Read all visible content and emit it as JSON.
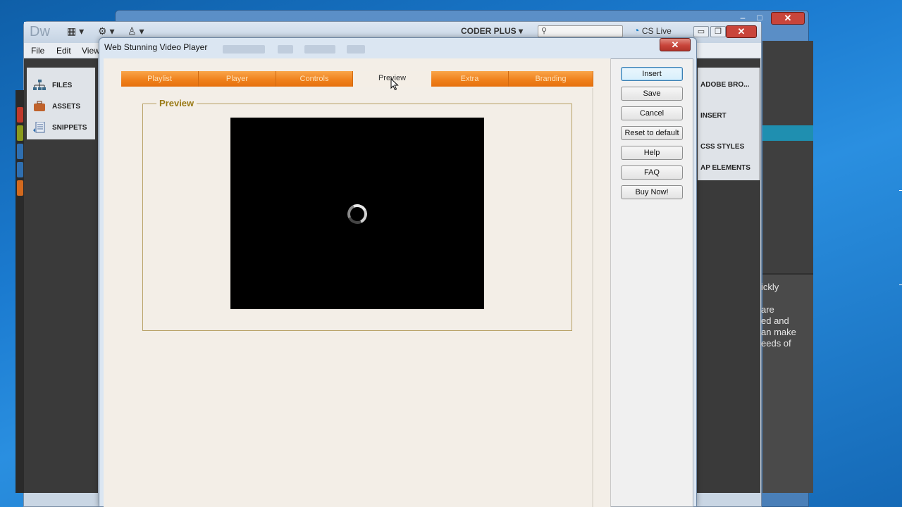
{
  "colors": {
    "tab_orange": "#ef7f1a",
    "group_label": "#9a7a15",
    "close_red": "#c9453b"
  },
  "back_window": {
    "controls": {
      "minimize": "–",
      "maximize": "□",
      "close": "✕"
    }
  },
  "dreamweaver": {
    "logo": "Dw",
    "workspace_label": "CODER PLUS",
    "search_placeholder": "",
    "cs_live": "CS Live",
    "window_controls": {
      "minimize": "▭",
      "restore": "❐",
      "close": "✕"
    },
    "menu": [
      "File",
      "Edit",
      "View"
    ],
    "right_menu_controls": "–  □  ✕",
    "files_panel": [
      {
        "label": "FILES",
        "icon": "sitemap-icon"
      },
      {
        "label": "ASSETS",
        "icon": "briefcase-icon"
      },
      {
        "label": "SNIPPETS",
        "icon": "snippets-icon"
      }
    ],
    "right_panel": [
      "ADOBE BRO...",
      "INSERT",
      "CSS STYLES",
      "AP ELEMENTS"
    ],
    "help_text": [
      "ickly",
      "are",
      "ed and",
      "an make",
      "eeds of"
    ]
  },
  "dialog": {
    "title": "Web Stunning Video Player",
    "close": "✕",
    "tabs": [
      {
        "label": "Playlist",
        "active": false
      },
      {
        "label": "Player",
        "active": false
      },
      {
        "label": "Controls",
        "active": false
      },
      {
        "label": "Preview",
        "active": true
      },
      {
        "label": "Extra",
        "active": false
      },
      {
        "label": "Branding",
        "active": false
      }
    ],
    "preview_group_label": "Preview",
    "video_state": "loading",
    "buttons": {
      "insert": "Insert",
      "save": "Save",
      "cancel": "Cancel",
      "reset": "Reset to default",
      "help": "Help",
      "faq": "FAQ",
      "buy": "Buy Now!"
    }
  }
}
